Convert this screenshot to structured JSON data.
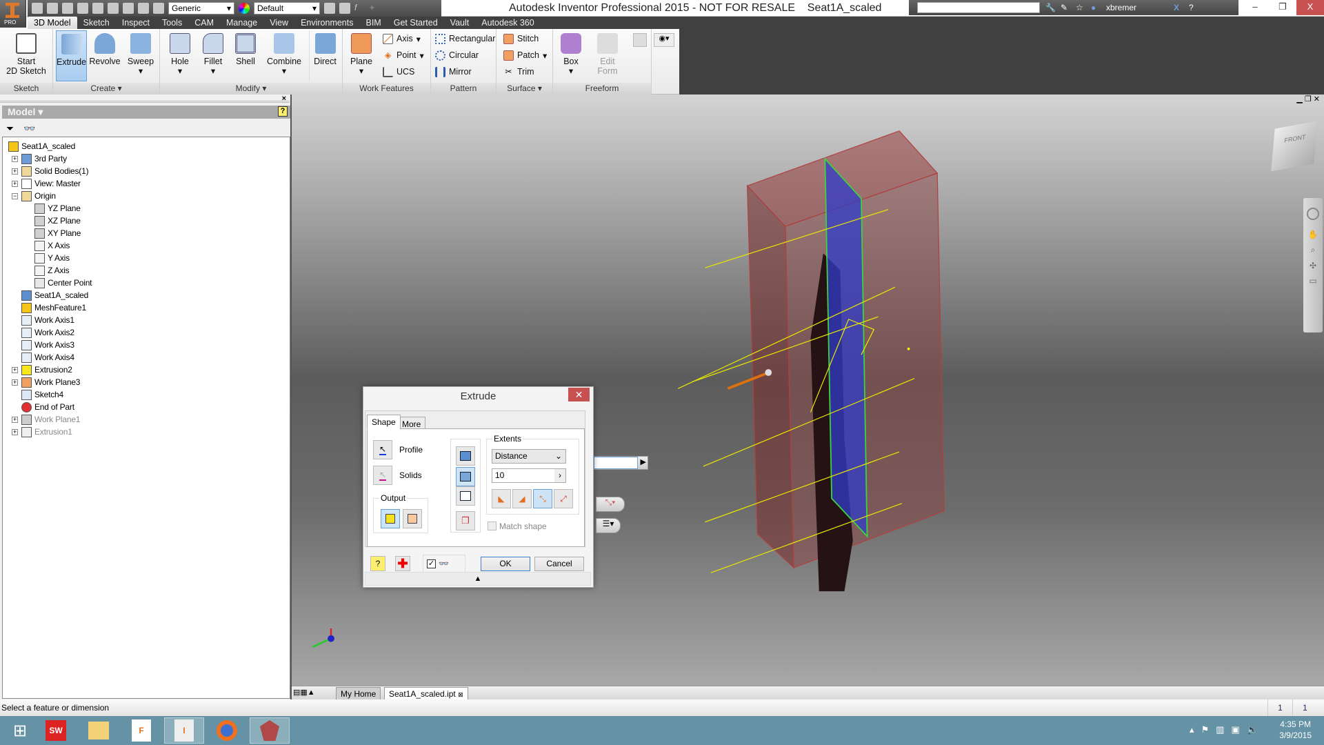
{
  "app": {
    "title": "Autodesk Inventor Professional 2015 - NOT FOR RESALE    Seat1A_scaled",
    "badge": "PRO"
  },
  "qat": {
    "material": "Generic",
    "appearance": "Default"
  },
  "infocenter": {
    "search_value": "",
    "user": "xbremer"
  },
  "window_controls": {
    "minimize": "–",
    "restore": "❐",
    "close": "X"
  },
  "menu_tabs": [
    "3D Model",
    "Sketch",
    "Inspect",
    "Tools",
    "CAM",
    "Manage",
    "View",
    "Environments",
    "BIM",
    "Get Started",
    "Vault",
    "Autodesk 360"
  ],
  "ribbon": {
    "panels": [
      "Sketch",
      "Create ▾",
      "Modify ▾",
      "Work Features",
      "Pattern",
      "Surface ▾",
      "Freeform"
    ],
    "sketch": {
      "start": "Start",
      "start2": "2D Sketch"
    },
    "create": [
      "Extrude",
      "Revolve",
      "Sweep"
    ],
    "modify": [
      "Hole",
      "Fillet",
      "Shell",
      "Combine",
      "Direct"
    ],
    "work_features": {
      "plane": "Plane",
      "axis": "Axis",
      "point": "Point",
      "ucs": "UCS"
    },
    "pattern": [
      "Rectangular",
      "Circular",
      "Mirror"
    ],
    "surface": [
      "Stitch",
      "Patch",
      "Trim"
    ],
    "freeform": {
      "box": "Box",
      "edit_form": "Edit",
      "edit_form2": "Form"
    }
  },
  "browser": {
    "title": "Model ▾",
    "help": "?",
    "tree": [
      {
        "label": "Seat1A_scaled",
        "level": 0,
        "exp": "",
        "icon": "part",
        "color": "#f5c518"
      },
      {
        "label": "3rd Party",
        "level": 1,
        "exp": "+",
        "icon": "third-party",
        "color": "#6f9bd6"
      },
      {
        "label": "Solid Bodies(1)",
        "level": 1,
        "exp": "+",
        "icon": "folder",
        "color": "#f0d79a"
      },
      {
        "label": "View: Master",
        "level": 1,
        "exp": "+",
        "icon": "view",
        "color": "#ffffff"
      },
      {
        "label": "Origin",
        "level": 1,
        "exp": "−",
        "icon": "folder-open",
        "color": "#f0d79a"
      },
      {
        "label": "YZ Plane",
        "level": 2,
        "exp": "",
        "icon": "plane",
        "color": "#d0d0d0"
      },
      {
        "label": "XZ Plane",
        "level": 2,
        "exp": "",
        "icon": "plane",
        "color": "#d0d0d0"
      },
      {
        "label": "XY Plane",
        "level": 2,
        "exp": "",
        "icon": "plane",
        "color": "#d0d0d0"
      },
      {
        "label": "X Axis",
        "level": 2,
        "exp": "",
        "icon": "axis",
        "color": "#f4f4f4"
      },
      {
        "label": "Y Axis",
        "level": 2,
        "exp": "",
        "icon": "axis",
        "color": "#f4f4f4"
      },
      {
        "label": "Z Axis",
        "level": 2,
        "exp": "",
        "icon": "axis",
        "color": "#f4f4f4"
      },
      {
        "label": "Center Point",
        "level": 2,
        "exp": "",
        "icon": "point",
        "color": "#e8e8e8"
      },
      {
        "label": "Seat1A_scaled",
        "level": 1,
        "exp": "",
        "icon": "mesh",
        "color": "#5b8fd0"
      },
      {
        "label": "MeshFeature1",
        "level": 1,
        "exp": "",
        "icon": "part",
        "color": "#f5c518"
      },
      {
        "label": "Work Axis1",
        "level": 1,
        "exp": "",
        "icon": "work-axis",
        "color": "#e6eef8"
      },
      {
        "label": "Work Axis2",
        "level": 1,
        "exp": "",
        "icon": "work-axis",
        "color": "#e6eef8"
      },
      {
        "label": "Work Axis3",
        "level": 1,
        "exp": "",
        "icon": "work-axis",
        "color": "#e6eef8"
      },
      {
        "label": "Work Axis4",
        "level": 1,
        "exp": "",
        "icon": "work-axis",
        "color": "#e6eef8"
      },
      {
        "label": "Extrusion2",
        "level": 1,
        "exp": "+",
        "icon": "extrusion",
        "color": "#f8e71c"
      },
      {
        "label": "Work Plane3",
        "level": 1,
        "exp": "+",
        "icon": "work-plane",
        "color": "#f0a060"
      },
      {
        "label": "Sketch4",
        "level": 1,
        "exp": "",
        "icon": "sketch",
        "color": "#dce8f5"
      },
      {
        "label": "End of Part",
        "level": 1,
        "exp": "",
        "icon": "end-of-part",
        "color": "#e03030"
      },
      {
        "label": "Work Plane1",
        "level": 1,
        "exp": "+",
        "icon": "work-plane",
        "color": "#cccccc",
        "dim": true
      },
      {
        "label": "Extrusion1",
        "level": 1,
        "exp": "+",
        "icon": "extrusion",
        "color": "#eeeeee",
        "dim": true
      }
    ]
  },
  "dialog": {
    "title": "Extrude",
    "tabs": [
      "Shape",
      "More"
    ],
    "profile": "Profile",
    "solids": "Solids",
    "output": "Output",
    "extents": "Extents",
    "extents_type": "Distance",
    "distance": "10",
    "match_shape": "Match shape",
    "match_shape_checked": false,
    "preview_checked": true,
    "ok": "OK",
    "cancel": "Cancel"
  },
  "doc_tabs": [
    "My Home",
    "Seat1A_scaled.ipt"
  ],
  "status": {
    "message": "Select a feature or dimension",
    "count1": "1",
    "count2": "1"
  },
  "taskbar": {
    "apps": [
      "windows-start",
      "solidworks",
      "file-explorer",
      "fusion-360",
      "inventor-pro",
      "firefox",
      "autodesk-app"
    ],
    "time": "4:35 PM",
    "date": "3/9/2015"
  },
  "viewcube": {
    "face": "FRONT"
  },
  "colors": {
    "accent": "#6aa0d8",
    "close_red": "#c75050",
    "taskbar": "#6593a5",
    "box_red": "#b04040",
    "plane_blue": "#3a3aa0",
    "sketch_yellow": "#e8e800"
  }
}
